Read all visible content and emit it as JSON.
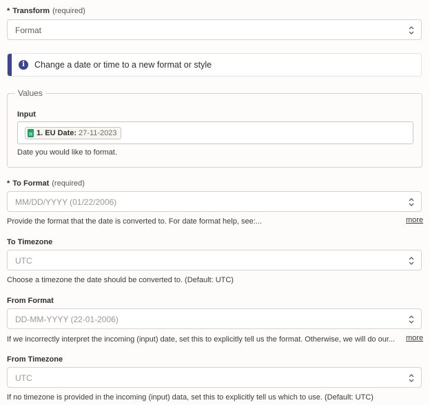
{
  "transform": {
    "star": "*",
    "label": "Transform",
    "required": "(required)",
    "value": "Format"
  },
  "info": {
    "text": "Change a date or time to a new format or style"
  },
  "values": {
    "legend": "Values",
    "input_label": "Input",
    "pill_name": "1. EU Date:",
    "pill_value": "27-11-2023",
    "help": "Date you would like to format."
  },
  "to_format": {
    "star": "*",
    "label": "To Format",
    "required": "(required)",
    "placeholder": "MM/DD/YYYY (01/22/2006)",
    "help": "Provide the format that the date is converted to. For date format help, see:...",
    "more": "more"
  },
  "to_timezone": {
    "label": "To Timezone",
    "value": "UTC",
    "help": "Choose a timezone the date should be converted to. (Default: UTC)"
  },
  "from_format": {
    "label": "From Format",
    "placeholder": "DD-MM-YYYY (22-01-2006)",
    "help": "If we incorrectly interpret the incoming (input) date, set this to explicitly tell us the format. Otherwise, we will do our...",
    "more": "more"
  },
  "from_timezone": {
    "label": "From Timezone",
    "value": "UTC",
    "help": "If no timezone is provided in the incoming (input) data, set this to explicitly tell us which to use. (Default: UTC)"
  }
}
